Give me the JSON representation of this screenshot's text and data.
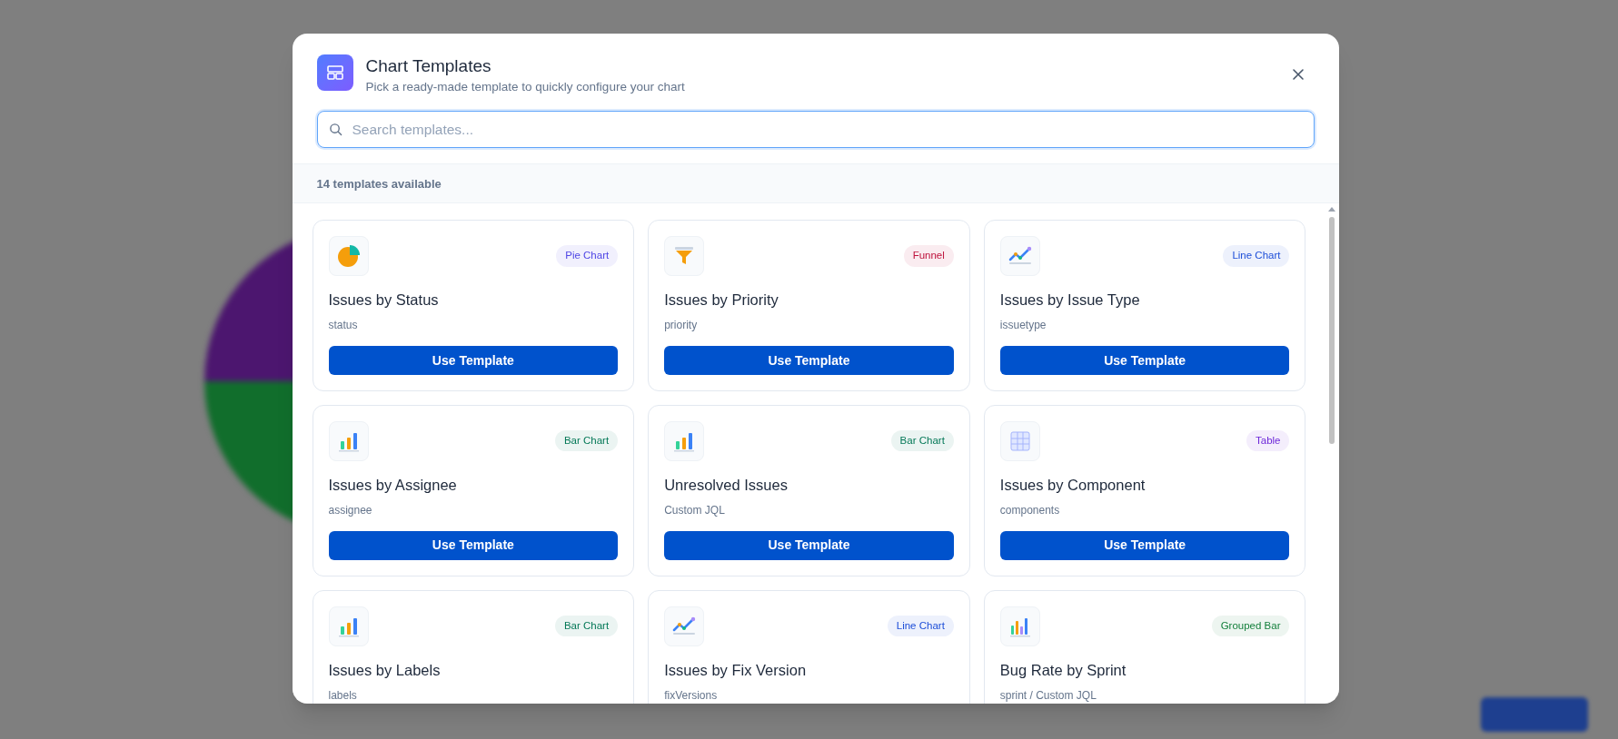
{
  "dialog": {
    "title": "Chart Templates",
    "subtitle": "Pick a ready-made template to quickly configure your chart",
    "search": {
      "placeholder": "Search templates..."
    },
    "count": "14 templates available",
    "templates": [
      {
        "title": "Issues by Status",
        "field": "status",
        "kind": "pie",
        "badge": {
          "label": "Pie Chart",
          "color": "#4f46e5"
        },
        "button": "Use Template"
      },
      {
        "title": "Issues by Priority",
        "field": "priority",
        "kind": "funnel",
        "badge": {
          "label": "Funnel",
          "color": "#be123c"
        },
        "button": "Use Template"
      },
      {
        "title": "Issues by Issue Type",
        "field": "issuetype",
        "kind": "line",
        "badge": {
          "label": "Line Chart",
          "color": "#1d4ed8"
        },
        "button": "Use Template"
      },
      {
        "title": "Issues by Assignee",
        "field": "assignee",
        "kind": "bar",
        "badge": {
          "label": "Bar Chart",
          "color": "#047857"
        },
        "button": "Use Template"
      },
      {
        "title": "Unresolved Issues",
        "field": "Custom JQL",
        "kind": "bar",
        "badge": {
          "label": "Bar Chart",
          "color": "#047857"
        },
        "button": "Use Template"
      },
      {
        "title": "Issues by Component",
        "field": "components",
        "kind": "table",
        "badge": {
          "label": "Table",
          "color": "#6d28d9"
        },
        "button": "Use Template"
      },
      {
        "title": "Issues by Labels",
        "field": "labels",
        "kind": "bar",
        "badge": {
          "label": "Bar Chart",
          "color": "#047857"
        }
      },
      {
        "title": "Issues by Fix Version",
        "field": "fixVersions",
        "kind": "line",
        "badge": {
          "label": "Line Chart",
          "color": "#1d4ed8"
        }
      },
      {
        "title": "Bug Rate by Sprint",
        "field": "sprint / Custom JQL",
        "kind": "grouped",
        "badge": {
          "label": "Grouped Bar",
          "color": "#15803d"
        }
      }
    ]
  }
}
